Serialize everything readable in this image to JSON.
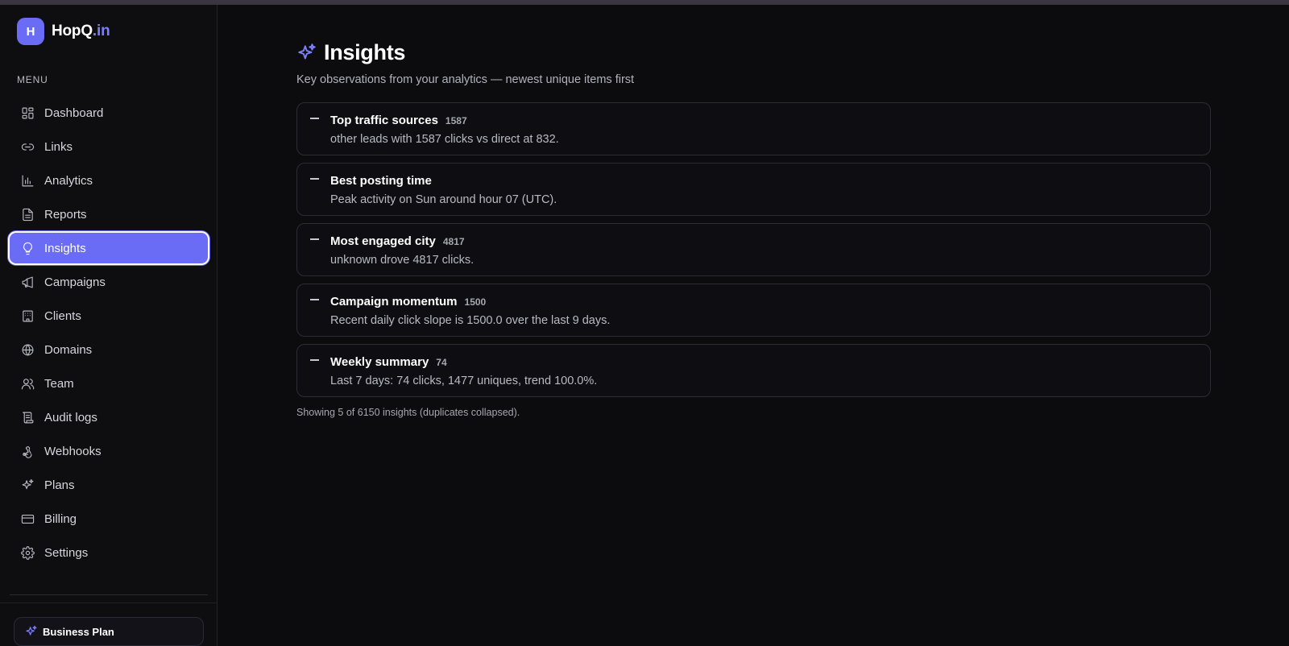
{
  "app": {
    "logo_letter": "H",
    "name": "HopQ",
    "tld": ".in"
  },
  "sidebar": {
    "menu_heading": "MENU",
    "items": [
      {
        "label": "Dashboard",
        "icon": "dashboard-icon"
      },
      {
        "label": "Links",
        "icon": "link-icon"
      },
      {
        "label": "Analytics",
        "icon": "bar-chart-icon"
      },
      {
        "label": "Reports",
        "icon": "document-icon"
      },
      {
        "label": "Insights",
        "icon": "lightbulb-icon",
        "active": true
      },
      {
        "label": "Campaigns",
        "icon": "megaphone-icon"
      },
      {
        "label": "Clients",
        "icon": "building-icon"
      },
      {
        "label": "Domains",
        "icon": "globe-icon"
      },
      {
        "label": "Team",
        "icon": "users-icon"
      },
      {
        "label": "Audit logs",
        "icon": "scroll-icon"
      },
      {
        "label": "Webhooks",
        "icon": "webhook-icon"
      },
      {
        "label": "Plans",
        "icon": "sparkles-icon"
      },
      {
        "label": "Billing",
        "icon": "credit-card-icon"
      },
      {
        "label": "Settings",
        "icon": "gear-icon"
      }
    ],
    "plan_label": "Business Plan"
  },
  "main": {
    "title": "Insights",
    "subtitle": "Key observations from your analytics — newest unique items first",
    "insights": [
      {
        "title": "Top traffic sources",
        "value": "1587",
        "description": "other leads with 1587 clicks vs direct at 832."
      },
      {
        "title": "Best posting time",
        "value": "",
        "description": "Peak activity on Sun around hour 07 (UTC)."
      },
      {
        "title": "Most engaged city",
        "value": "4817",
        "description": "unknown drove 4817 clicks."
      },
      {
        "title": "Campaign momentum",
        "value": "1500",
        "description": "Recent daily click slope is 1500.0 over the last 9 days."
      },
      {
        "title": "Weekly summary",
        "value": "74",
        "description": "Last 7 days: 74 clicks, 1477 uniques, trend 100.0%."
      }
    ],
    "footnote": "Showing 5 of 6150 insights (duplicates collapsed)."
  },
  "colors": {
    "accent": "#6b6cf6",
    "background": "#0c0c0f",
    "sidebar": "#0e0e11"
  }
}
